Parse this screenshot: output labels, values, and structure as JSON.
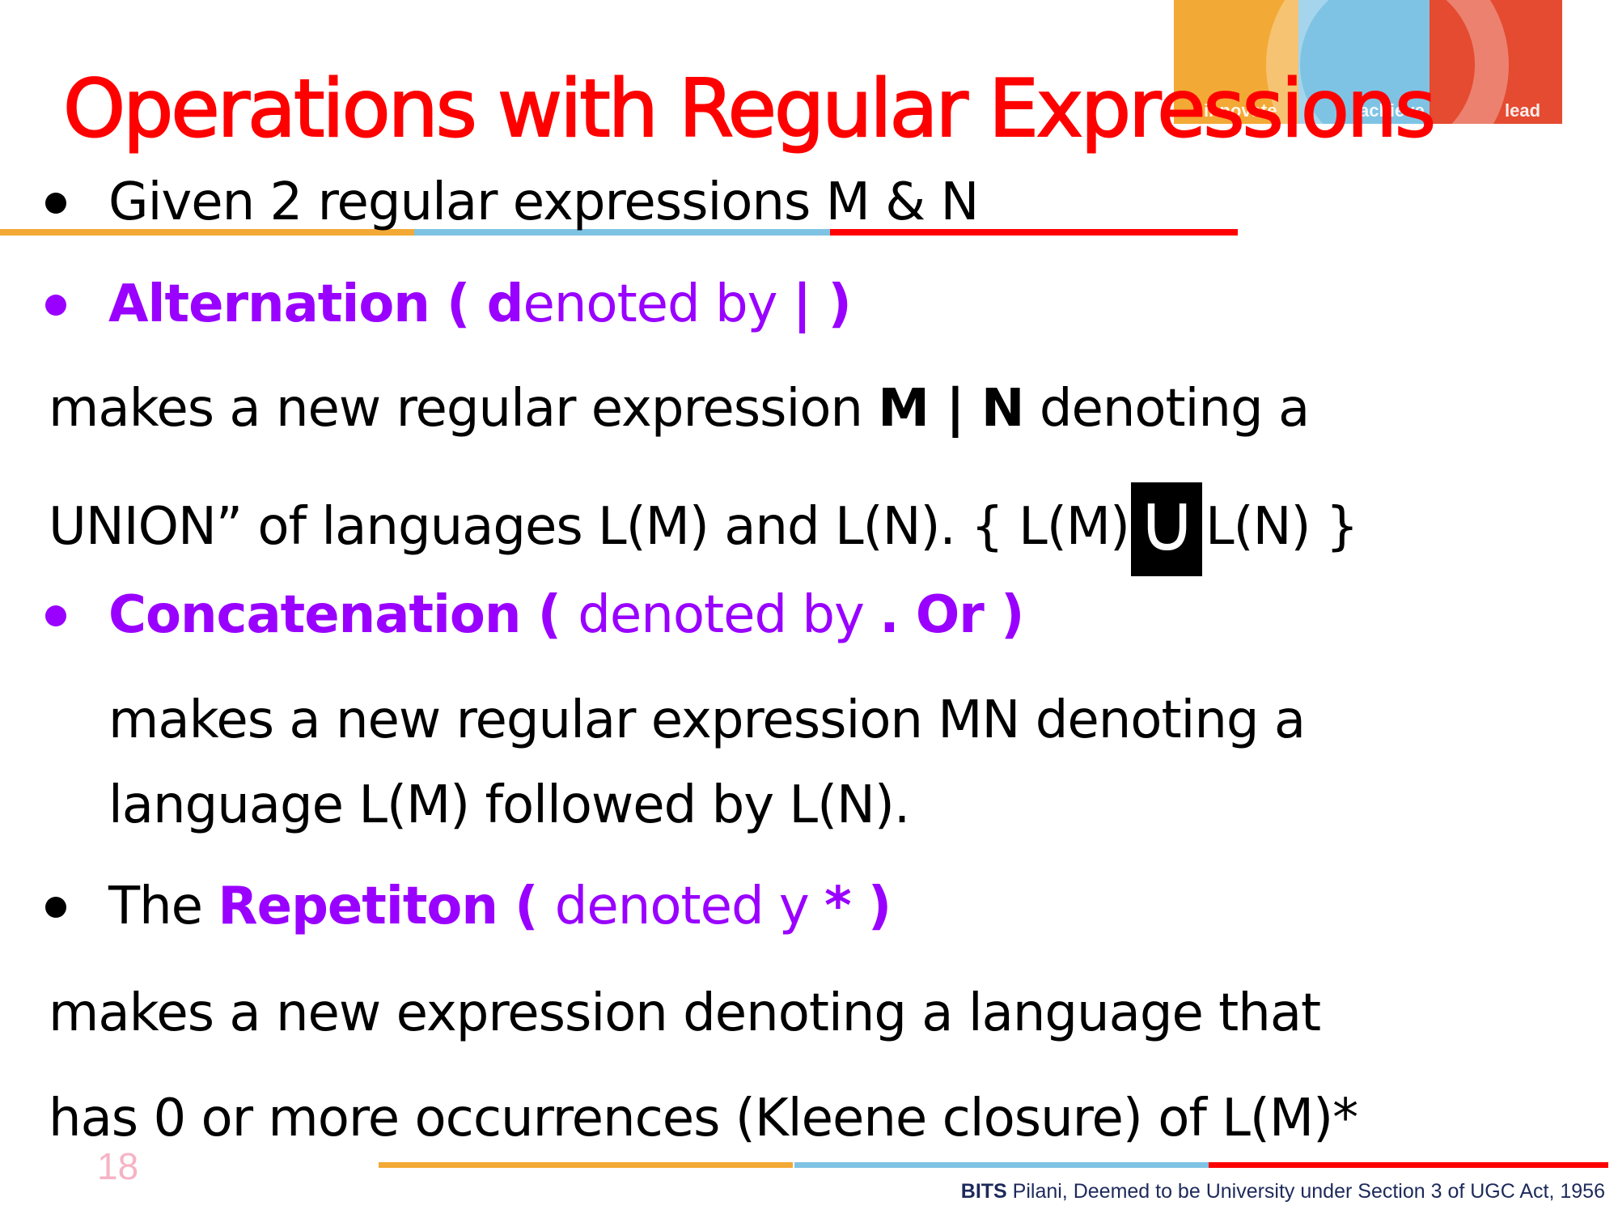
{
  "banner": {
    "words": [
      "innovate",
      "achieve",
      "lead"
    ]
  },
  "title": "Operations with Regular Expressions",
  "bullet1": {
    "text": "Given 2 regular expressions M & N"
  },
  "alternation": {
    "bold_label": "Alternation ( d",
    "rest": "enoted by ",
    "symbol": " | )",
    "line1_prefix": "makes a new regular expression ",
    "line1_bold": "M | N",
    "line1_suffix": " denoting a",
    "line2_text": " UNION” of languages L(M) and L(N). { L(M)",
    "union_symbol": "∪",
    "line2_end": "L(N) }"
  },
  "concatenation": {
    "bold_label": "Concatenation ( ",
    "rest": "denoted by ",
    "symbol": ". Or  )",
    "line1": "makes a new regular expression MN denoting a",
    "line2": "language L(M) followed by L(N)."
  },
  "repetition": {
    "prefix": "The ",
    "bold_label": "Repetiton ( ",
    "rest": "denoted y ",
    "symbol": " * )",
    "line1": "makes a new expression denoting a language that",
    "line2": "has 0 or more occurrences (Kleene closure) of L(M)*"
  },
  "page_number": "18",
  "footer": {
    "brand": "BITS",
    "text": " Pilani, Deemed to be University under Section 3 of UGC Act, 1956"
  },
  "colors": {
    "title": "#ff0000",
    "emphasis": "#9900ff",
    "orange": "#f3a935",
    "blue": "#7fc3e4",
    "red": "#e44b31",
    "page_number": "#f6b3c6"
  }
}
